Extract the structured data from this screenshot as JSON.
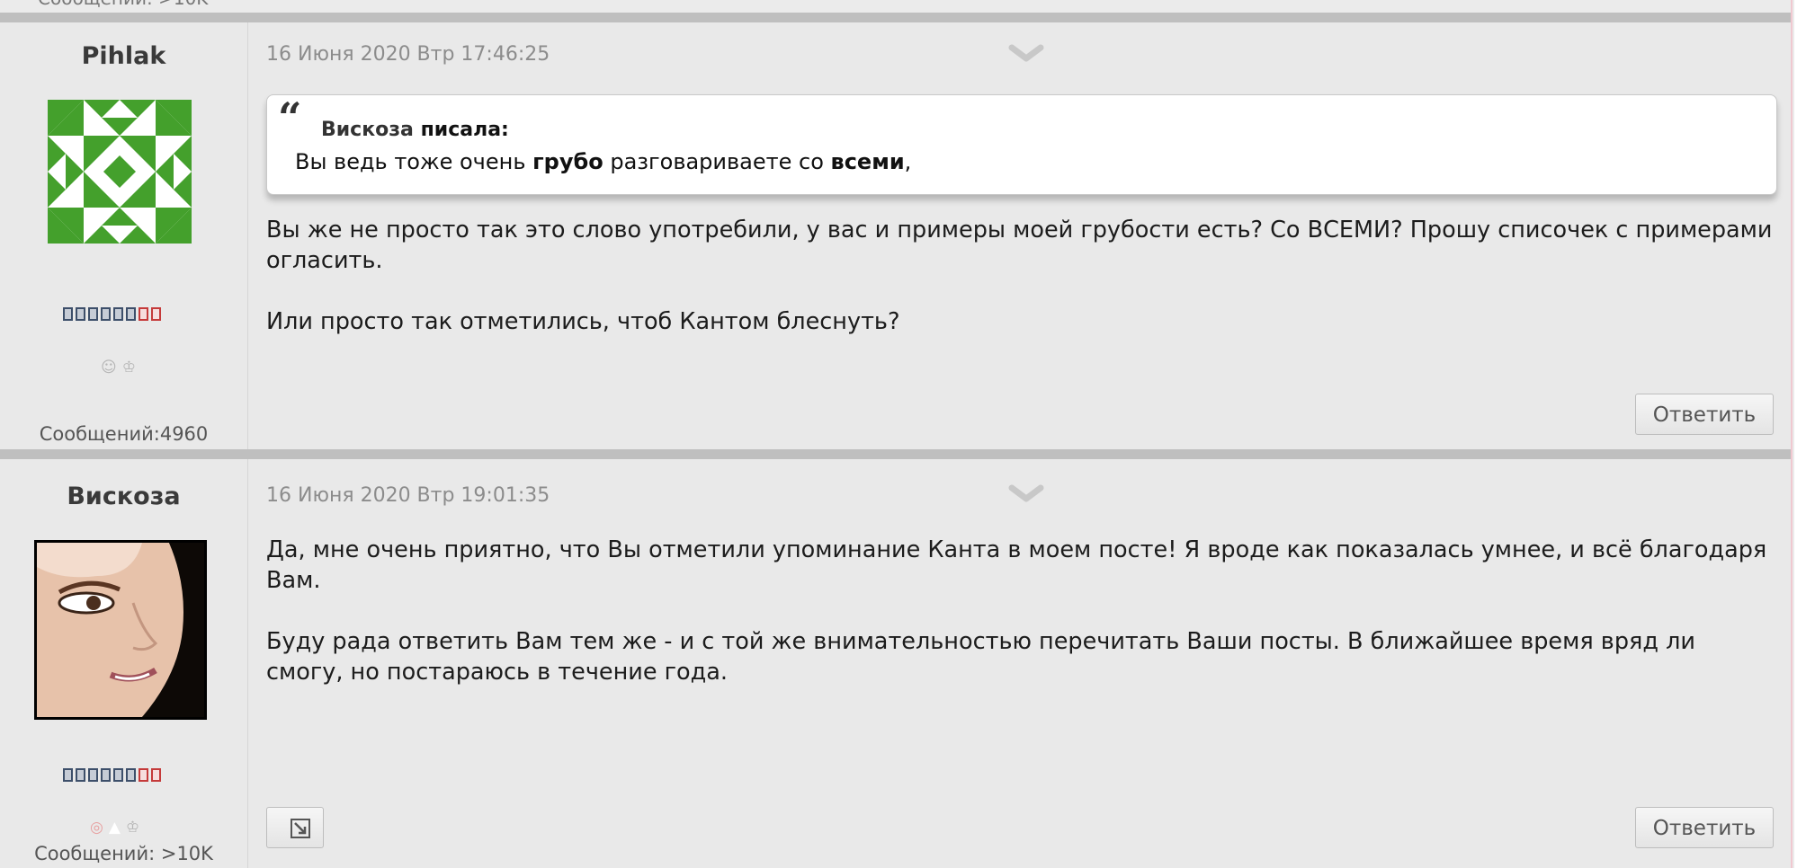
{
  "top_stub": {
    "text": "Сообщений: >10K"
  },
  "posts": [
    {
      "author": "Pihlak",
      "avatar_icon": "identicon-green",
      "rank_icon": "rank-blocks-icon",
      "badges": [
        "☺",
        "♔"
      ],
      "message_count": "Сообщений:4960",
      "date": "16 Июня 2020 Втр 17:46:25",
      "quote": {
        "author": "Вискоза",
        "wrote": "писала:",
        "parts": [
          "Вы ведь тоже очень ",
          "грубо",
          " разговариваете со ",
          "всеми",
          ","
        ]
      },
      "paragraphs": [
        "Вы же не просто так это слово употребили, у вас и примеры моей грубости есть? Со ВСЕМИ? Прошу списочек с примерами огласить.",
        "Или просто так отметились, чтоб Кантом блеснуть?"
      ],
      "reply_label": "Ответить"
    },
    {
      "author": "Вискоза",
      "avatar_icon": "woman-portrait",
      "rank_icon": "rank-blocks-icon",
      "badges": [
        "◎",
        "▲",
        "♔"
      ],
      "message_count": "Сообщений: >10K",
      "date": "16 Июня 2020 Втр 19:01:35",
      "paragraphs": [
        "Да, мне очень приятно, что Вы отметили упоминание Канта в моем посте! Я вроде как показалась умнее, и всё благодаря Вам.",
        "Буду рада ответить Вам тем же - и с той же внимательностью перечитать Ваши посты. В ближайшее время вряд ли смогу, но постараюсь в течение года."
      ],
      "reply_label": "Ответить"
    }
  ],
  "colors": {
    "background": "#e9e9e9",
    "separator": "#bfbfbf",
    "text": "#1c1c1c",
    "date": "#8c8c8c"
  }
}
